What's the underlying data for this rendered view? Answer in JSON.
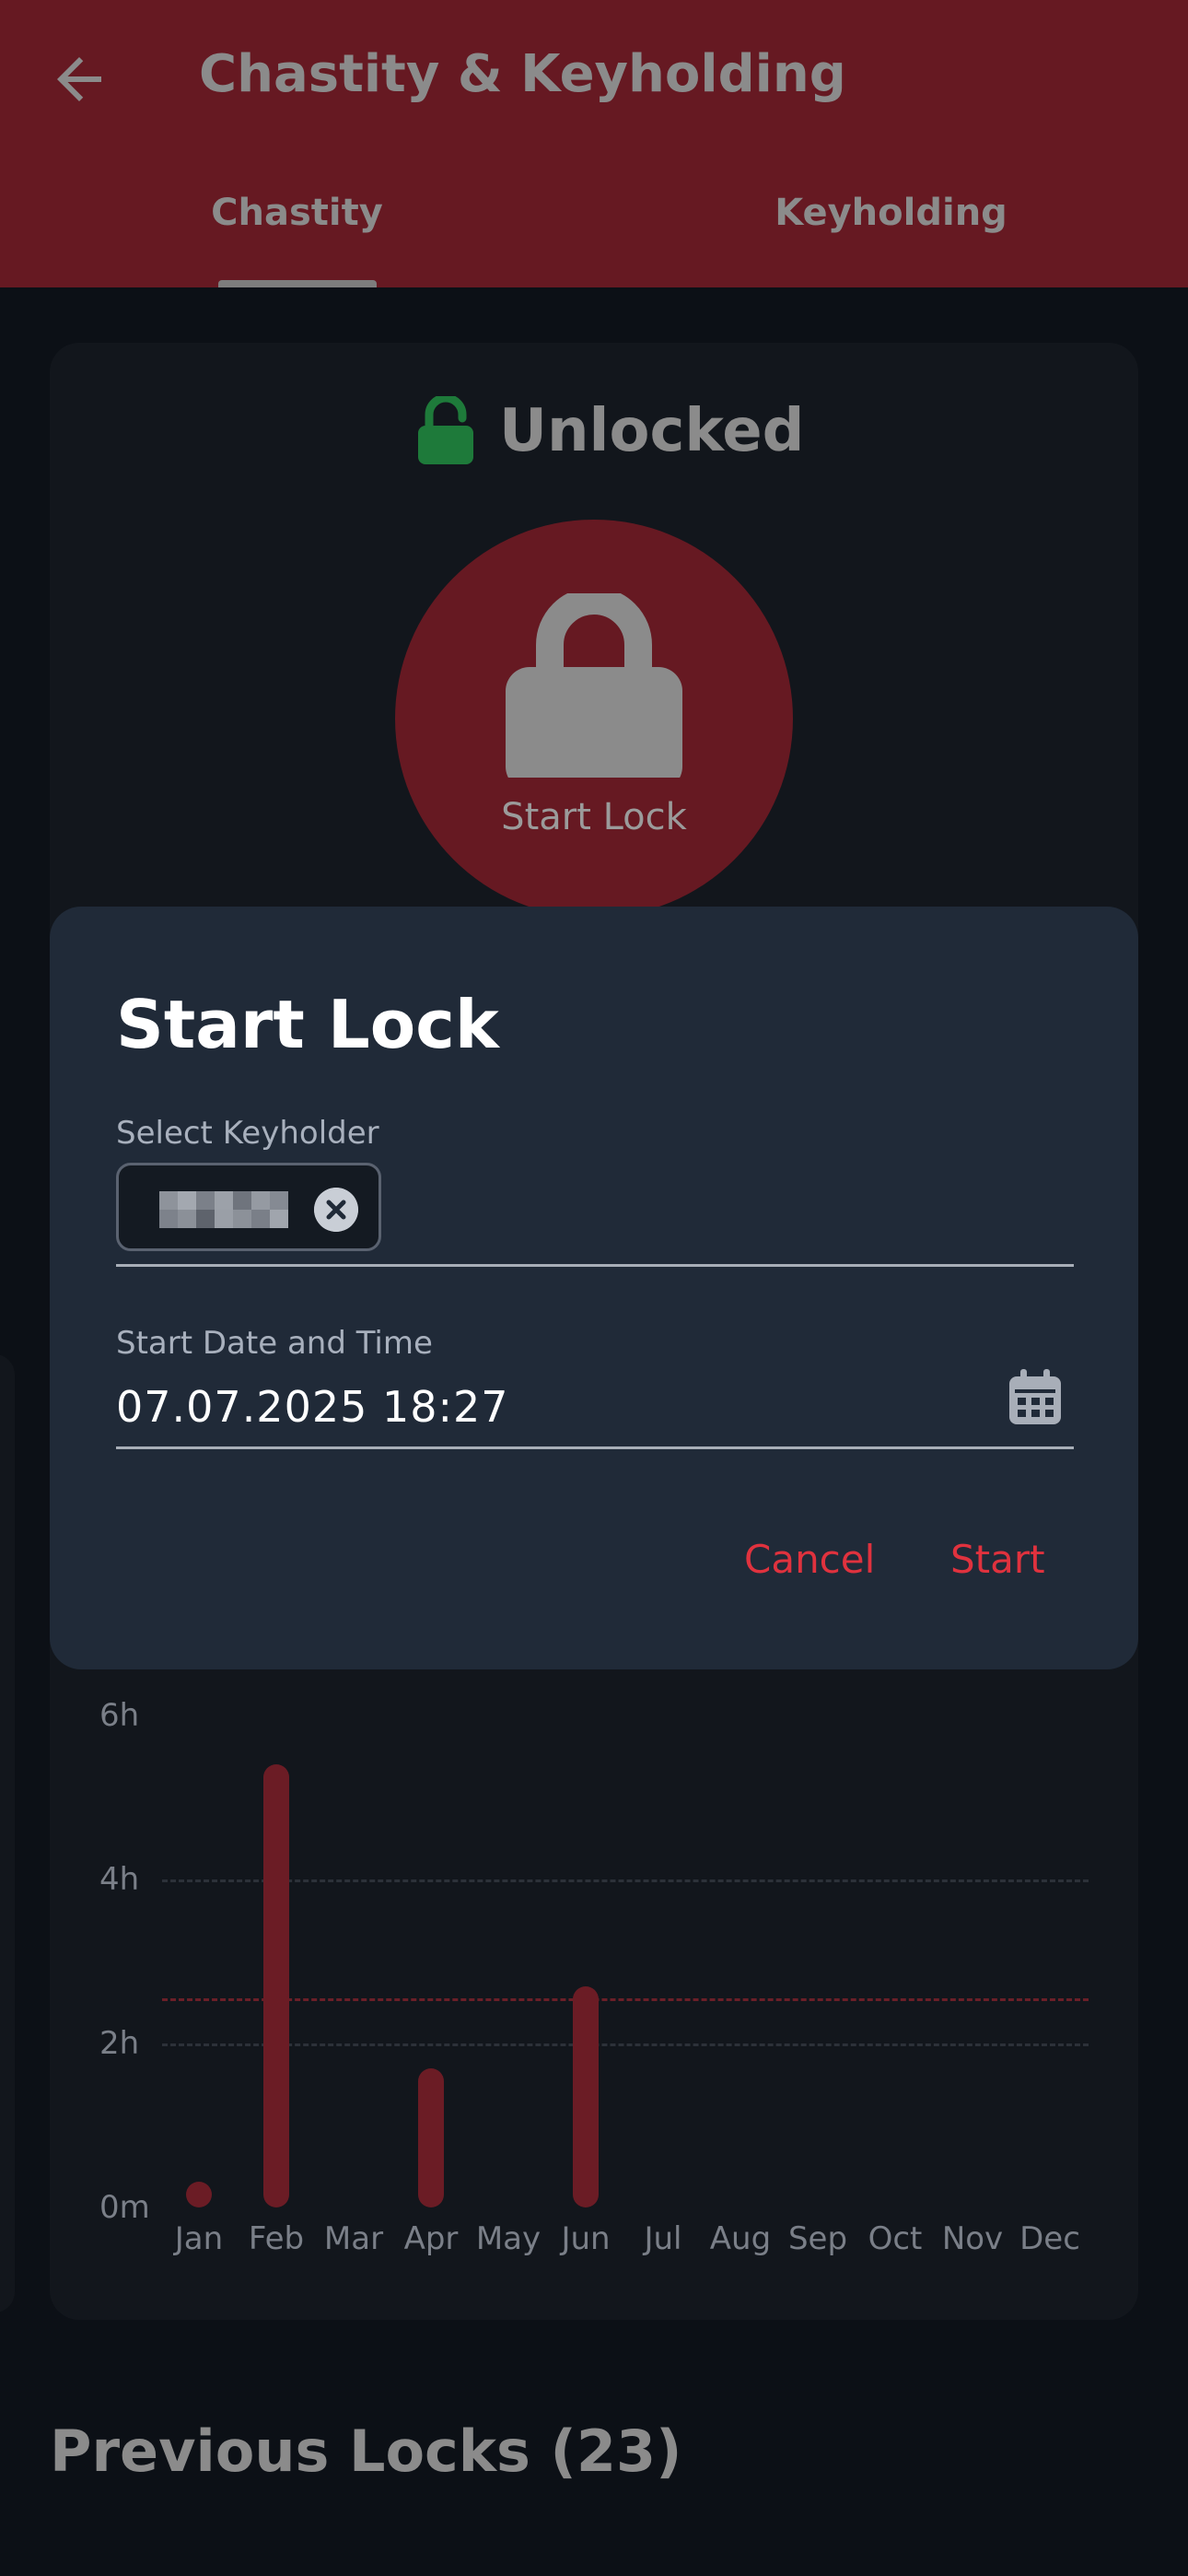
{
  "appbar": {
    "title": "Chastity & Keyholding",
    "back_icon": "arrow-left-icon"
  },
  "tabs": [
    {
      "label": "Chastity",
      "selected": true
    },
    {
      "label": "Keyholding",
      "selected": false
    }
  ],
  "status": {
    "text": "Unlocked",
    "icon": "unlocked-padlock-icon",
    "icon_color": "#1e7a3a"
  },
  "start_button": {
    "label": "Start Lock",
    "icon": "lock-icon"
  },
  "dialog": {
    "title": "Start Lock",
    "keyholder_label": "Select Keyholder",
    "keyholder_chip_icon": "clear-icon",
    "date_label": "Start Date and Time",
    "date_value": "07.07.2025 18:27",
    "date_icon": "calendar-icon",
    "cancel_label": "Cancel",
    "start_label": "Start"
  },
  "chart_data": {
    "type": "bar",
    "categories": [
      "Jan",
      "Feb",
      "Mar",
      "Apr",
      "May",
      "Jun",
      "Jul",
      "Aug",
      "Sep",
      "Oct",
      "Nov",
      "Dec"
    ],
    "values": [
      0.1,
      5.4,
      0,
      1.7,
      0,
      2.7,
      0,
      0,
      0,
      0,
      0,
      0
    ],
    "y_unit": "hours",
    "ylim": [
      0,
      6
    ],
    "yticks": [
      "0m",
      "2h",
      "4h",
      "6h"
    ],
    "average_line": 2.55,
    "grid": true,
    "colors": {
      "bar": "#6b1c25",
      "average_line": "#6b1f28"
    }
  },
  "previous_locks": {
    "title": "Previous Locks (23)"
  }
}
